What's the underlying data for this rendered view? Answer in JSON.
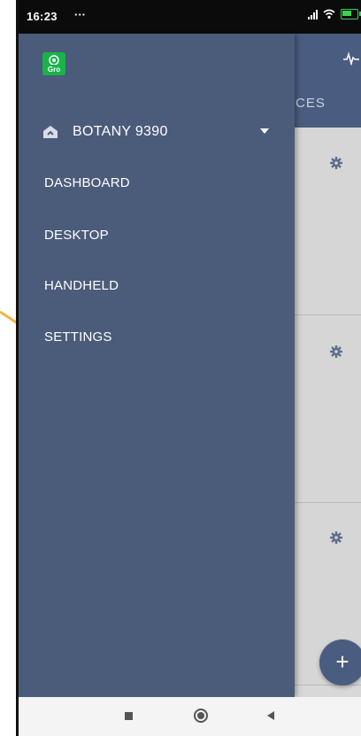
{
  "status_bar": {
    "time": "16:23",
    "dots": "···"
  },
  "background": {
    "tab_label": "CES"
  },
  "drawer": {
    "logo_text": "Gro",
    "site": "BOTANY 9390",
    "items": [
      {
        "label": "DASHBOARD"
      },
      {
        "label": "DESKTOP"
      },
      {
        "label": "HANDHELD"
      },
      {
        "label": "SETTINGS"
      }
    ]
  },
  "fab_label": "+",
  "colors": {
    "drawer": "#4b5b7a",
    "header": "#4a5d80",
    "logo": "#19b34a",
    "annotation": "#f2b43a"
  },
  "icons": [
    "signal-icon",
    "wifi-icon",
    "battery-icon",
    "pulse-icon",
    "gear-icon",
    "home-icon",
    "caret-down-icon",
    "recents-icon",
    "home-nav-icon",
    "back-icon"
  ]
}
